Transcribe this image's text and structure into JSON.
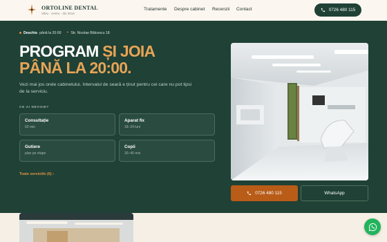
{
  "header": {
    "brand": "ORTOLINE DENTAL",
    "tagline": "Sibiu · centru · din 2016",
    "nav": [
      {
        "label": "Tratamente"
      },
      {
        "label": "Despre cabinet"
      },
      {
        "label": "Recenzii"
      },
      {
        "label": "Contact"
      }
    ],
    "phone_cta": "0726 480 115",
    "phone_icon": "phone-icon"
  },
  "hero": {
    "status_open": "Deschis",
    "status_hours": " · până la 20:00",
    "address": "Str. Nicolae Bălcescu 18",
    "headline_line1_white": "PROGRAM ",
    "headline_line1_orange": "ȘI JOIA",
    "headline_line2": "PÂNĂ LA 20:00.",
    "intro": "Vezi mai jos orele cabinetului. Intervalul de seară e ținut pentru cei care nu pot lipsi de la serviciu.",
    "section_label": "CE AI NEVOIE?",
    "services": [
      {
        "title": "Consultație",
        "sub": "60 min"
      },
      {
        "title": "Aparat fix",
        "sub": "18–24 luni"
      },
      {
        "title": "Gutiere",
        "sub": "plan pe etape"
      },
      {
        "title": "Copii",
        "sub": "30–40 min"
      }
    ],
    "services_link": "Toate serviciile (6) ›",
    "call_button": "0726 480 115",
    "whatsapp_button": "WhatsApp"
  },
  "colors": {
    "background": "#1f4136",
    "accent": "#e7a456",
    "call_button": "#b85c18",
    "whatsapp": "#22b35c"
  }
}
